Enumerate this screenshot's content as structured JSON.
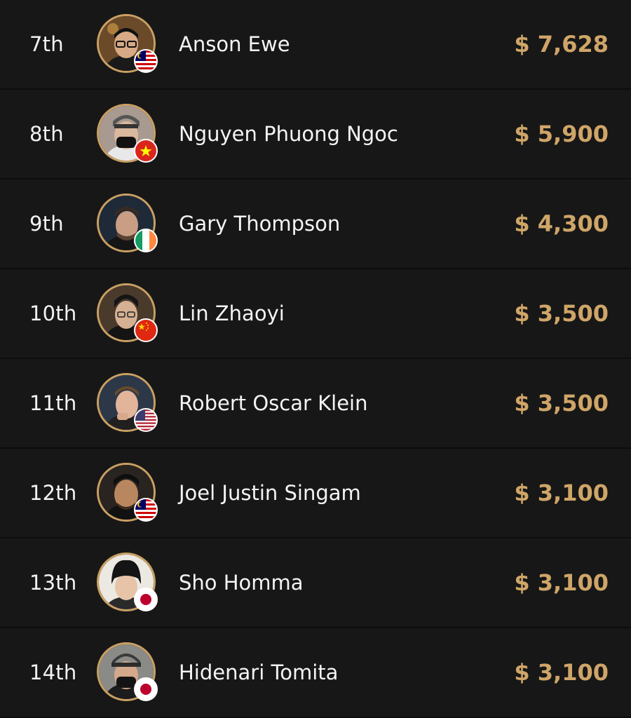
{
  "colors": {
    "background": "#171717",
    "accent_gold": "#cfa568",
    "avatar_ring": "#c9a063",
    "text": "#f4f4f4"
  },
  "players": [
    {
      "rank": "7th",
      "name": "Anson Ewe",
      "prize": "$ 7,628",
      "country": "Malaysia",
      "flag_icon": "malaysia-flag-icon"
    },
    {
      "rank": "8th",
      "name": "Nguyen Phuong Ngoc",
      "prize": "$ 5,900",
      "country": "Vietnam",
      "flag_icon": "vietnam-flag-icon"
    },
    {
      "rank": "9th",
      "name": "Gary Thompson",
      "prize": "$ 4,300",
      "country": "Ireland",
      "flag_icon": "ireland-flag-icon"
    },
    {
      "rank": "10th",
      "name": "Lin Zhaoyi",
      "prize": "$ 3,500",
      "country": "China",
      "flag_icon": "china-flag-icon"
    },
    {
      "rank": "11th",
      "name": "Robert Oscar Klein",
      "prize": "$ 3,500",
      "country": "United States",
      "flag_icon": "usa-flag-icon"
    },
    {
      "rank": "12th",
      "name": "Joel Justin Singam",
      "prize": "$ 3,100",
      "country": "Malaysia",
      "flag_icon": "malaysia-flag-icon"
    },
    {
      "rank": "13th",
      "name": "Sho Homma",
      "prize": "$ 3,100",
      "country": "Japan",
      "flag_icon": "japan-flag-icon"
    },
    {
      "rank": "14th",
      "name": "Hidenari Tomita",
      "prize": "$ 3,100",
      "country": "Japan",
      "flag_icon": "japan-flag-icon"
    }
  ]
}
